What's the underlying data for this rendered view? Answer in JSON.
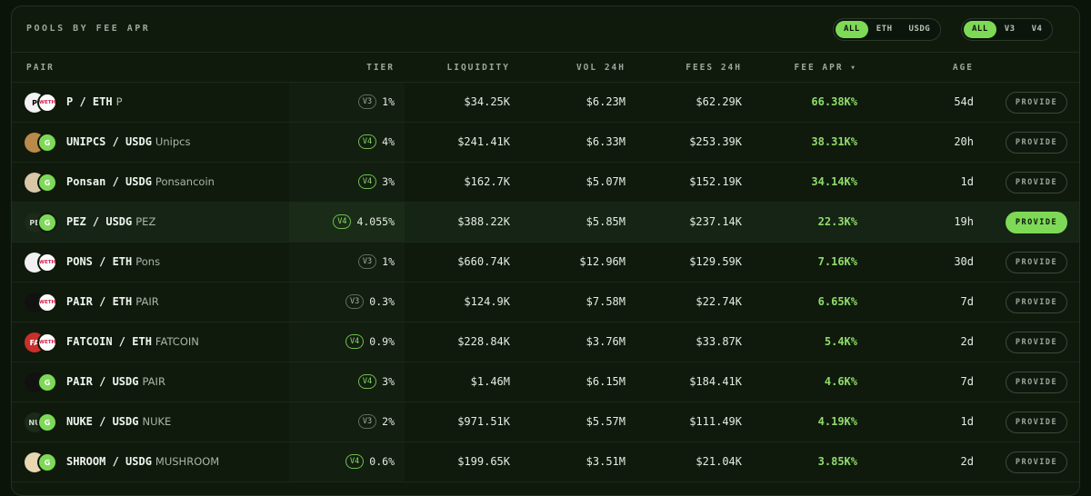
{
  "header": {
    "title": "POOLS BY FEE APR",
    "filter_chain": [
      "ALL",
      "ETH",
      "USDG"
    ],
    "filter_chain_active": 0,
    "filter_version": [
      "ALL",
      "V3",
      "V4"
    ],
    "filter_version_active": 0
  },
  "columns": {
    "pair": "PAIR",
    "tier": "TIER",
    "liquidity": "LIQUIDITY",
    "vol": "VOL 24H",
    "fees": "FEES 24H",
    "apr": "FEE APR ▾",
    "age": "AGE"
  },
  "colors": {
    "accent": "#7ed957",
    "bg": "#0f1a0d"
  },
  "provide_label": "PROVIDE",
  "rows": [
    {
      "pair": "P / ETH",
      "name": "P",
      "version": "V3",
      "tier": "1%",
      "liquidity": "$34.25K",
      "vol": "$6.23M",
      "fees": "$62.29K",
      "apr": "66.38K%",
      "age": "54d",
      "icon_a": {
        "text": "P",
        "bg": "#f3f3f3",
        "fg": "#000000"
      },
      "icon_b": {
        "text": "WETH",
        "bg": "#ffffff",
        "fg": "#d6204b"
      }
    },
    {
      "pair": "UNIPCS / USDG",
      "name": "Unipcs",
      "version": "V4",
      "tier": "4%",
      "liquidity": "$241.41K",
      "vol": "$6.33M",
      "fees": "$253.39K",
      "apr": "38.31K%",
      "age": "20h",
      "icon_a": {
        "text": "",
        "bg": "#b98a4a",
        "fg": "#000000"
      },
      "icon_b": {
        "text": "G",
        "bg": "#7ed957",
        "fg": "#ffffff"
      }
    },
    {
      "pair": "Ponsan / USDG",
      "name": "Ponsancoin",
      "version": "V4",
      "tier": "3%",
      "liquidity": "$162.7K",
      "vol": "$5.07M",
      "fees": "$152.19K",
      "apr": "34.14K%",
      "age": "1d",
      "icon_a": {
        "text": "",
        "bg": "#d9c7a8",
        "fg": "#000000"
      },
      "icon_b": {
        "text": "G",
        "bg": "#7ed957",
        "fg": "#ffffff"
      }
    },
    {
      "pair": "PEZ / USDG",
      "name": "PEZ",
      "version": "V4",
      "tier": "4.055%",
      "liquidity": "$388.22K",
      "vol": "$5.85M",
      "fees": "$237.14K",
      "apr": "22.3K%",
      "age": "19h",
      "highlight": true,
      "icon_a": {
        "text": "PE",
        "bg": "#1b2a19",
        "fg": "#cfd8cd"
      },
      "icon_b": {
        "text": "G",
        "bg": "#7ed957",
        "fg": "#ffffff"
      }
    },
    {
      "pair": "PONS / ETH",
      "name": "Pons",
      "version": "V3",
      "tier": "1%",
      "liquidity": "$660.74K",
      "vol": "$12.96M",
      "fees": "$129.59K",
      "apr": "7.16K%",
      "age": "30d",
      "icon_a": {
        "text": "",
        "bg": "#f1f1f1",
        "fg": "#000000"
      },
      "icon_b": {
        "text": "WETH",
        "bg": "#ffffff",
        "fg": "#d6204b"
      }
    },
    {
      "pair": "PAIR / ETH",
      "name": "PAIR",
      "version": "V3",
      "tier": "0.3%",
      "liquidity": "$124.9K",
      "vol": "$7.58M",
      "fees": "$22.74K",
      "apr": "6.65K%",
      "age": "7d",
      "icon_a": {
        "text": "",
        "bg": "#111111",
        "fg": "#ffffff"
      },
      "icon_b": {
        "text": "WETH",
        "bg": "#ffffff",
        "fg": "#d6204b"
      }
    },
    {
      "pair": "FATCOIN / ETH",
      "name": "FATCOIN",
      "version": "V4",
      "tier": "0.9%",
      "liquidity": "$228.84K",
      "vol": "$3.76M",
      "fees": "$33.87K",
      "apr": "5.4K%",
      "age": "2d",
      "icon_a": {
        "text": "FA",
        "bg": "#c9302c",
        "fg": "#ffffff"
      },
      "icon_b": {
        "text": "WETH",
        "bg": "#ffffff",
        "fg": "#d6204b"
      }
    },
    {
      "pair": "PAIR / USDG",
      "name": "PAIR",
      "version": "V4",
      "tier": "3%",
      "liquidity": "$1.46M",
      "vol": "$6.15M",
      "fees": "$184.41K",
      "apr": "4.6K%",
      "age": "7d",
      "icon_a": {
        "text": "",
        "bg": "#111111",
        "fg": "#ffffff"
      },
      "icon_b": {
        "text": "G",
        "bg": "#7ed957",
        "fg": "#ffffff"
      }
    },
    {
      "pair": "NUKE / USDG",
      "name": "NUKE",
      "version": "V3",
      "tier": "2%",
      "liquidity": "$971.51K",
      "vol": "$5.57M",
      "fees": "$111.49K",
      "apr": "4.19K%",
      "age": "1d",
      "icon_a": {
        "text": "NU",
        "bg": "#1b2a19",
        "fg": "#cfd8cd"
      },
      "icon_b": {
        "text": "G",
        "bg": "#7ed957",
        "fg": "#ffffff"
      }
    },
    {
      "pair": "SHROOM / USDG",
      "name": "MUSHROOM",
      "version": "V4",
      "tier": "0.6%",
      "liquidity": "$199.65K",
      "vol": "$3.51M",
      "fees": "$21.04K",
      "apr": "3.85K%",
      "age": "2d",
      "icon_a": {
        "text": "",
        "bg": "#e8d7b0",
        "fg": "#000000"
      },
      "icon_b": {
        "text": "G",
        "bg": "#7ed957",
        "fg": "#ffffff"
      }
    }
  ]
}
